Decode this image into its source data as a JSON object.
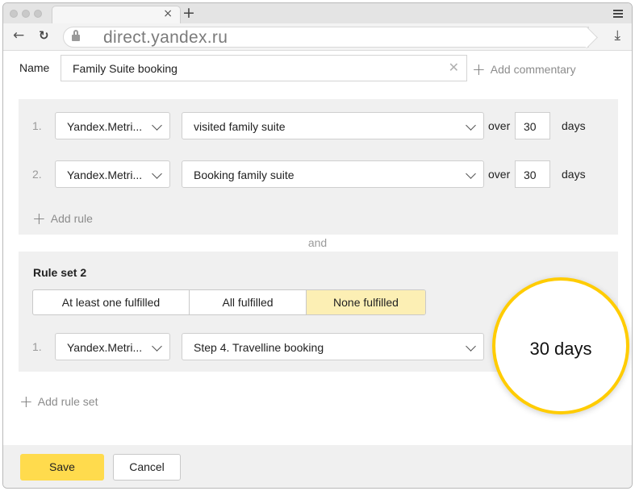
{
  "browser": {
    "url": "direct.yandex.ru",
    "tab_close": "×",
    "new_tab": "+"
  },
  "form": {
    "name_label": "Name",
    "name_value": "Family Suite booking",
    "add_commentary": "Add commentary"
  },
  "ruleset1": {
    "rules": [
      {
        "num": "1.",
        "source": "Yandex.Metri...",
        "goal": "visited family suite",
        "over": "over",
        "days_value": "30",
        "days_label": "days"
      },
      {
        "num": "2.",
        "source": "Yandex.Metri...",
        "goal": "Booking family suite",
        "over": "over",
        "days_value": "30",
        "days_label": "days"
      }
    ],
    "add_rule": "Add rule"
  },
  "connector": "and",
  "ruleset2": {
    "title": "Rule set 2",
    "modes": [
      "At least one fulfilled",
      "All fulfilled",
      "None fulfilled"
    ],
    "selected_mode": "None fulfilled",
    "rules": [
      {
        "num": "1.",
        "source": "Yandex.Metri...",
        "goal": "Step 4. Travelline booking"
      }
    ]
  },
  "add_rule_set": "Add rule set",
  "footer": {
    "save": "Save",
    "cancel": "Cancel"
  },
  "callout": "30 days",
  "colors": {
    "accent": "#ffdb4d",
    "selected_segment": "#fcefb4",
    "callout_ring": "#ffcc00",
    "panel_bg": "#f0f0f0"
  }
}
